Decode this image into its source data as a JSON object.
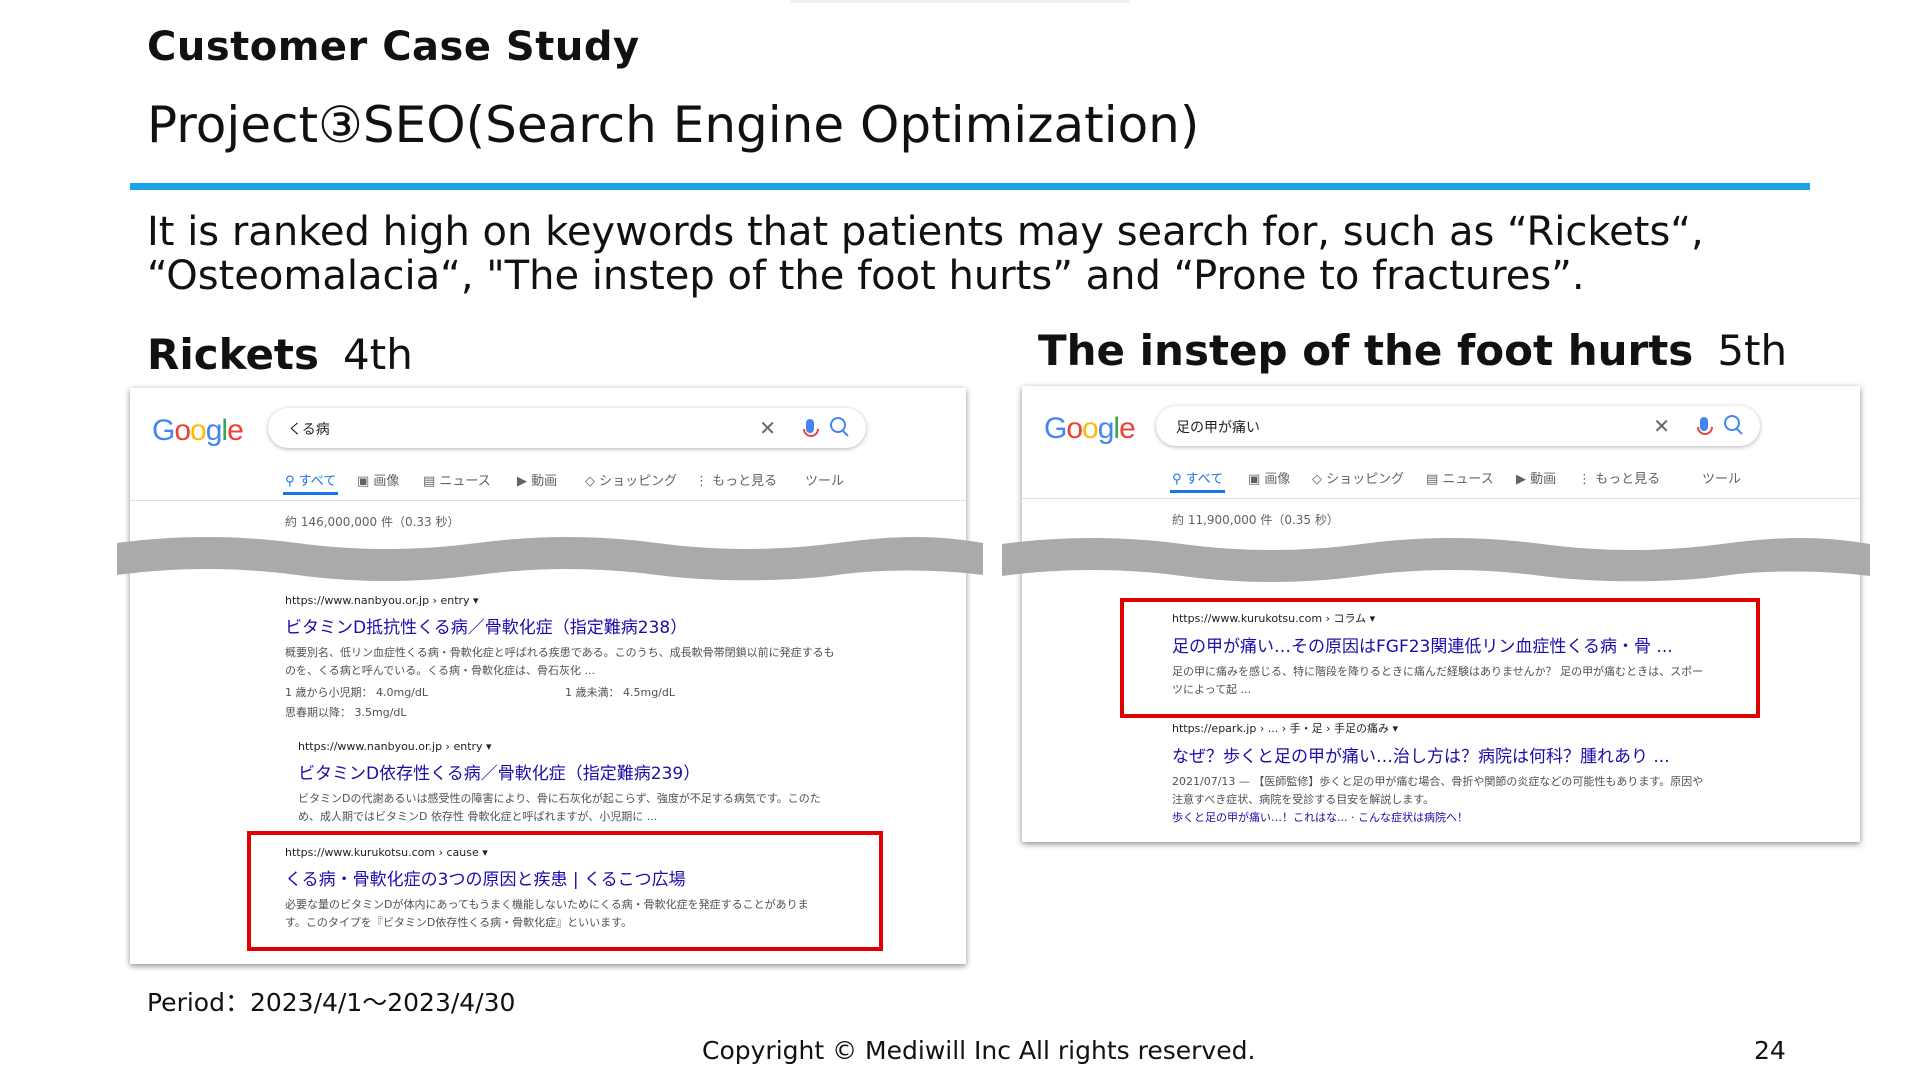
{
  "slide": {
    "kicker": "Customer Case Study",
    "title": "Project③SEO(Search Engine Optimization)",
    "description": "It is ranked high on keywords that patients may search for, such as “Rickets“, “Osteomalacia“, \"The instep of the foot hurts” and “Prone to fractures”.",
    "period": "Period：2023/4/1～2023/4/30",
    "copyright": "Copyright © Mediwill Inc All rights reserved.",
    "page_number": "24",
    "colors": {
      "accent_rule": "#1aa3e6",
      "highlight": "#e00000",
      "link": "#1a0dab"
    }
  },
  "left": {
    "heading": "Rickets",
    "rank": "4th",
    "search": {
      "logo": "Google",
      "query": "くる病",
      "clear_icon": "close-icon",
      "tabs": [
        "すべて",
        "画像",
        "ニュース",
        "動画",
        "ショッピング",
        "もっと見る",
        "ツール"
      ],
      "count": "約 146,000,000 件（0.33 秒）"
    },
    "results": [
      {
        "url": "https://www.nanbyou.or.jp › entry ▾",
        "title": "ビタミンD抵抗性くる病／骨軟化症（指定難病238）",
        "snippet": "概要別名、低リン血症性くる病・骨軟化症と呼ばれる疾患である。このうち、成長軟骨帯閉鎖以前に発症するものを、くる病と呼んでいる。くる病・骨軟化症は、骨石灰化 ...",
        "extra": [
          "1 歳から小児期： 4.0mg/dL",
          "1 歳未満： 4.5mg/dL",
          "思春期以降： 3.5mg/dL"
        ]
      },
      {
        "url": "https://www.nanbyou.or.jp › entry ▾",
        "title": "ビタミンD依存性くる病／骨軟化症（指定難病239）",
        "snippet": "ビタミンDの代謝あるいは感受性の障害により、骨に石灰化が起こらず、強度が不足する病気です。このため、成人期ではビタミンD 依存性 骨軟化症と呼ばれますが、小児期に ..."
      },
      {
        "url": "https://www.kurukotsu.com › cause ▾",
        "title": "くる病・骨軟化症の3つの原因と疾患 | くるこつ広場",
        "snippet": "必要な量のビタミンDが体内にあってもうまく機能しないためにくる病・骨軟化症を発症することがあります。このタイプを『ビタミンD依存性くる病・骨軟化症』といいます。"
      }
    ]
  },
  "right": {
    "heading": "The instep of the foot hurts",
    "rank": "5th",
    "search": {
      "logo": "Google",
      "query": "足の甲が痛い",
      "tabs": [
        "すべて",
        "画像",
        "ショッピング",
        "ニュース",
        "動画",
        "もっと見る",
        "ツール"
      ],
      "count": "約 11,900,000 件（0.35 秒）"
    },
    "results": [
      {
        "url": "https://www.kurukotsu.com › コラム ▾",
        "title": "足の甲が痛い…その原因はFGF23関連低リン血症性くる病・骨 ...",
        "snippet": "足の甲に痛みを感じる、特に階段を降りるときに痛んだ経験はありませんか？ 足の甲が痛むときは、スポーツによって起 ..."
      },
      {
        "url": "https://epark.jp › ... › 手・足 › 手足の痛み ▾",
        "title": "なぜ？歩くと足の甲が痛い…治し方は？病院は何科？腫れあり ...",
        "snippet": "2021/07/13 — 【医師監修】歩くと足の甲が痛む場合、骨折や関節の炎症などの可能性もあります。原因や注意すべき症状、病院を受診する目安を解説します。",
        "sitelink": "歩くと足の甲が痛い…！これはな... · こんな症状は病院へ！"
      }
    ]
  }
}
